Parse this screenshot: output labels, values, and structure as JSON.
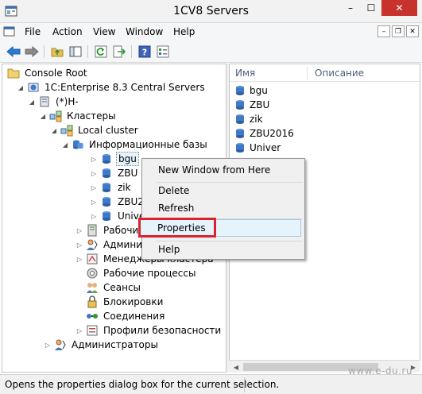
{
  "window": {
    "title": "1CV8 Servers",
    "minimize": "–",
    "maximize": "☐",
    "close": "✕"
  },
  "menu": [
    "File",
    "Action",
    "View",
    "Window",
    "Help"
  ],
  "mdi_buttons": [
    "–",
    "❐",
    "✕"
  ],
  "toolbar_icons": [
    "back-arrow-icon",
    "forward-arrow-icon",
    "up-folder-icon",
    "show-hide-tree-icon",
    "refresh-icon",
    "export-list-icon",
    "help-icon",
    "properties-icon"
  ],
  "tree": [
    {
      "label": "Console Root",
      "icon": "folder-icon",
      "expander": ""
    },
    {
      "label": "1C:Enterprise 8.3 Central Servers",
      "icon": "servers-icon",
      "expander": "◢"
    },
    {
      "label": "(*)H-",
      "icon": "server-icon",
      "expander": "◢"
    },
    {
      "label": "Кластеры",
      "icon": "clusters-icon",
      "expander": "◢"
    },
    {
      "label": "Local cluster",
      "icon": "cluster-icon",
      "expander": "◢"
    },
    {
      "label": "Информационные базы",
      "icon": "infobases-icon",
      "expander": "◢"
    },
    {
      "label": "bgu",
      "icon": "database-icon",
      "expander": "▷"
    },
    {
      "label": "ZBU",
      "icon": "database-icon",
      "expander": "▷"
    },
    {
      "label": "zik",
      "icon": "database-icon",
      "expander": "▷"
    },
    {
      "label": "ZBU2016",
      "icon": "database-icon",
      "expander": "▷"
    },
    {
      "label": "Univer",
      "icon": "database-icon",
      "expander": "▷"
    },
    {
      "label": "Рабочие серверы",
      "icon": "work-servers-icon",
      "expander": "▷"
    },
    {
      "label": "Администраторы",
      "icon": "admins-icon",
      "expander": "▷"
    },
    {
      "label": "Менеджеры кластера",
      "icon": "managers-icon",
      "expander": "▷"
    },
    {
      "label": "Рабочие процессы",
      "icon": "processes-icon",
      "expander": ""
    },
    {
      "label": "Сеансы",
      "icon": "sessions-icon",
      "expander": ""
    },
    {
      "label": "Блокировки",
      "icon": "locks-icon",
      "expander": ""
    },
    {
      "label": "Соединения",
      "icon": "connections-icon",
      "expander": ""
    },
    {
      "label": "Профили безопасности",
      "icon": "security-profiles-icon",
      "expander": "▷"
    },
    {
      "label": "Администраторы",
      "icon": "admins-icon",
      "expander": "▷"
    }
  ],
  "list": {
    "columns": [
      "Имя",
      "Описание"
    ],
    "rows": [
      "bgu",
      "ZBU",
      "zik",
      "ZBU2016",
      "Univer"
    ]
  },
  "context_menu": {
    "items": [
      "New Window from Here",
      "Delete",
      "Refresh",
      "Properties",
      "Help"
    ],
    "highlighted": "Properties"
  },
  "status_bar": {
    "text": "Opens the properties dialog box for the current selection."
  },
  "watermark": "www.e-du.ru",
  "colors": {
    "accent_highlight": "#e5f3fb",
    "red_box": "#d9232e",
    "close_red": "#c7322d"
  }
}
